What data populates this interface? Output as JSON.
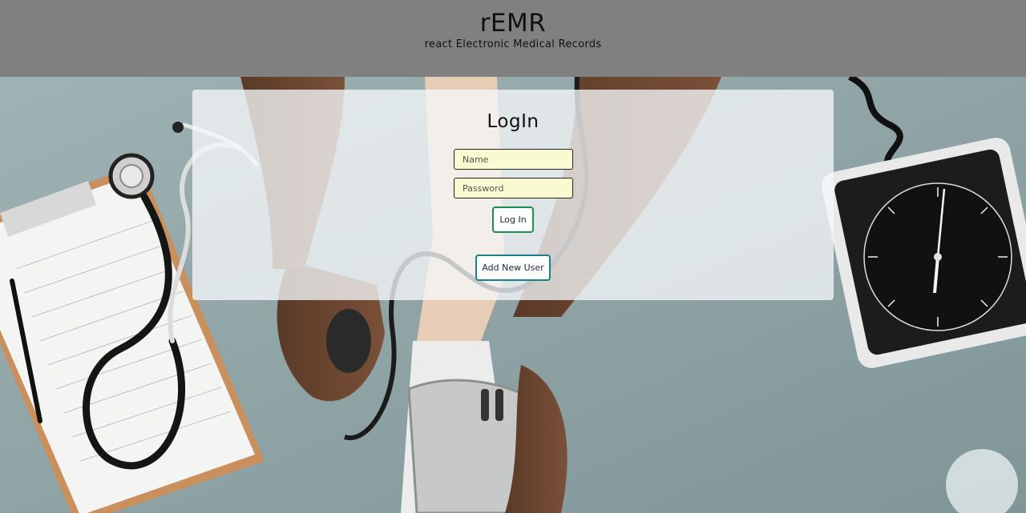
{
  "header": {
    "title": "rEMR",
    "subtitle": "react Electronic Medical Records"
  },
  "login": {
    "title": "LogIn",
    "name_placeholder": "Name",
    "password_placeholder": "Password",
    "login_button": "Log In",
    "add_user_button": "Add New User"
  },
  "colors": {
    "header_bg": "#808080",
    "input_bg": "#fafad2",
    "login_border": "#1e8e4e",
    "add_user_border": "#1b7f86"
  }
}
